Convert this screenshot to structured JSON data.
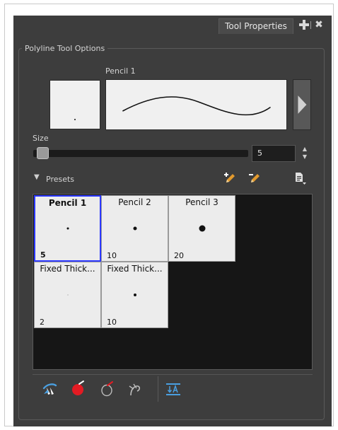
{
  "window": {
    "tab_title": "Tool Properties",
    "add_icon": "plus-icon",
    "close_icon": "close-icon",
    "close_glyph": "✖"
  },
  "options": {
    "group_title": "Polyline Tool Options",
    "current_preset_name": "Pencil 1",
    "size_label": "Size",
    "size_value": "5",
    "slider_level": 0.05
  },
  "presets": {
    "toggle_glyph": "▼",
    "label": "Presets",
    "new_preset_icon": "new-brush-preset-icon",
    "rename_preset_icon": "rename-brush-preset-icon",
    "menu_icon": "preset-menu-icon",
    "items": [
      {
        "name": "Pencil 1",
        "size": "5",
        "selected": true
      },
      {
        "name": "Pencil 2",
        "size": "10",
        "selected": false
      },
      {
        "name": "Pencil 3",
        "size": "20",
        "selected": false
      },
      {
        "name": "Fixed Thick...",
        "size": "2",
        "selected": false
      },
      {
        "name": "Fixed Thick...",
        "size": "10",
        "selected": false
      }
    ]
  },
  "bottom_toolbar": {
    "icons": [
      "auto-fill-icon",
      "create-colour-art-icon",
      "create-line-art-icon",
      "auto-flatten-icon",
      "arrange-order-icon"
    ]
  },
  "colors": {
    "panel_bg": "#3d3d3d",
    "selection_border": "#2d39ff",
    "tool_red": "#e31b23",
    "tool_blue": "#4a9fe0"
  }
}
